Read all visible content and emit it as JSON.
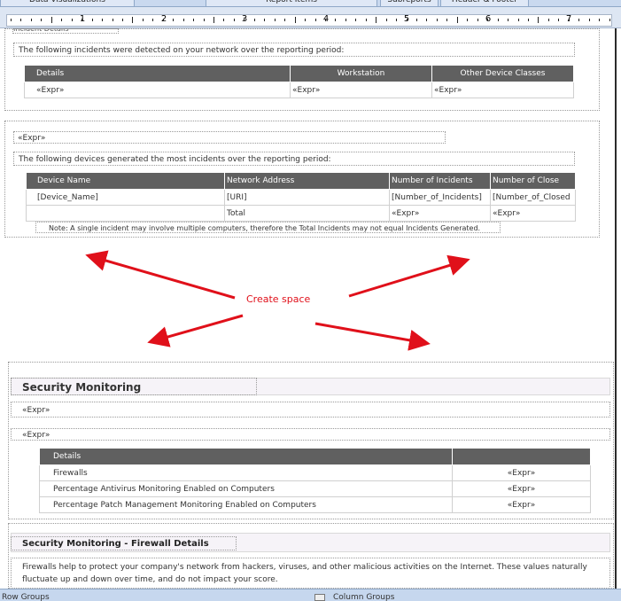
{
  "tabs": [
    "Data Visualizations",
    "Report Items",
    "Subreports",
    "Header & Footer"
  ],
  "ruler": {
    "numbers": [
      "1",
      "2",
      "3",
      "4",
      "5",
      "6",
      "7"
    ]
  },
  "incidents": {
    "partial_title": "Incident Details",
    "intro": "The following incidents were detected on your network over the reporting period:",
    "headers": [
      "Details",
      "Workstation",
      "Other Device Classes"
    ],
    "row": [
      "«Expr»",
      "«Expr»",
      "«Expr»"
    ]
  },
  "devices": {
    "expr_label": "«Expr»",
    "intro": "The following devices generated the most incidents over the reporting period:",
    "headers": [
      "Device Name",
      "Network Address",
      "Number of Incidents",
      "Number of Close"
    ],
    "rows": [
      [
        "[Device_Name]",
        "[URI]",
        "[Number_of_Incidents]",
        "[Number_of_Closed"
      ],
      [
        "",
        "Total",
        "«Expr»",
        "«Expr»"
      ]
    ],
    "note": "Note: A single incident may involve multiple computers, therefore the Total Incidents may not equal Incidents Generated."
  },
  "annotation": {
    "label": "Create space",
    "color": "#e0101a"
  },
  "security": {
    "title": "Security Monitoring",
    "expr1": "«Expr»",
    "expr2": "«Expr»",
    "headers": [
      "Details",
      ""
    ],
    "rows": [
      [
        "Firewalls",
        "«Expr»"
      ],
      [
        "Percentage Antivirus Monitoring Enabled on Computers",
        "«Expr»"
      ],
      [
        "Percentage Patch Management Monitoring Enabled on Computers",
        "«Expr»"
      ]
    ]
  },
  "firewall": {
    "title": "Security Monitoring - Firewall Details",
    "text_line1": "Firewalls help to protect your company's network from hackers, viruses, and other malicious activities on the Internet. These values naturally",
    "text_line2": "fluctuate up and down over time, and do not impact your score."
  },
  "status_bar": {
    "left": "Row Groups",
    "right": "Column Groups"
  },
  "colors": {
    "header_bg": "#606060",
    "accent_red": "#e0101a",
    "chrome_blue": "#c9d9ef"
  }
}
